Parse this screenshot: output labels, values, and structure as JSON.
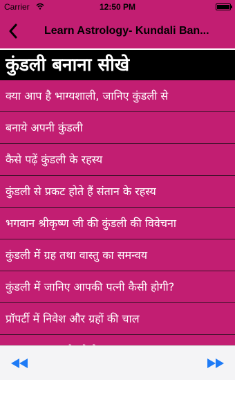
{
  "status_bar": {
    "carrier": "Carrier",
    "time": "12:50 PM"
  },
  "nav": {
    "title": "Learn Astrology- Kundali Ban..."
  },
  "heading": "कुंडली बनाना सीखे",
  "items": [
    {
      "label": "क्या आप है भाग्यशाली, जानिए कुंडली से"
    },
    {
      "label": "बनाये अपनी कुंडली"
    },
    {
      "label": "कैसे पढ़ें कुंडली के रहस्य"
    },
    {
      "label": "कुंडली से प्रकट होते हैं संतान के रहस्य"
    },
    {
      "label": "भगवान श्रीकृष्ण जी की कुंडली की विवेचना"
    },
    {
      "label": "कुंडली में ग्रह तथा वास्तु का समन्वय"
    },
    {
      "label": "कुंडली में जानिए आपकी पत्नी कैसी होगी?"
    },
    {
      "label": "प्रॉपर्टी में निवेश और ग्रहों की चाल"
    },
    {
      "label": "धन लाभ कब और कैसे?"
    }
  ],
  "toolbar": {
    "prev_icon": "rewind-icon",
    "next_icon": "fast-forward-icon"
  },
  "colors": {
    "primary": "#c21e72",
    "heading_bg": "#000000",
    "toolbar_icon": "#1e7bf6"
  }
}
